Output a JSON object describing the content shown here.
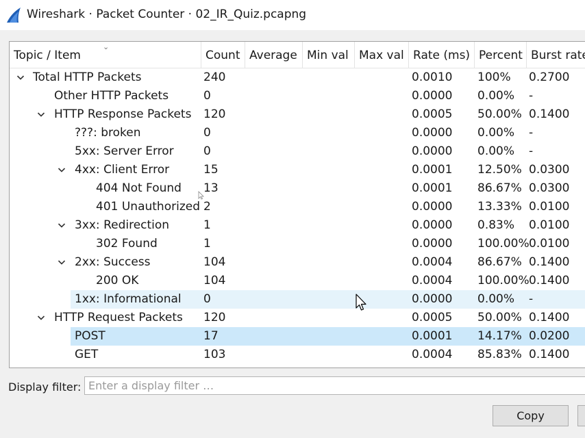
{
  "window": {
    "title": "Wireshark · Packet Counter · 02_IR_Quiz.pcapng",
    "icon": "wireshark-fin-icon",
    "accent": "#1f5fb6"
  },
  "columns": [
    "Topic / Item",
    "Count",
    "Average",
    "Min val",
    "Max val",
    "Rate (ms)",
    "Percent",
    "Burst rate"
  ],
  "rows": [
    {
      "level": 0,
      "expander": "open",
      "topic": "Total HTTP Packets",
      "count": "240",
      "rate": "0.0010",
      "percent": "100%",
      "burst": "0.2700"
    },
    {
      "level": 1,
      "expander": "none",
      "topic": "Other HTTP Packets",
      "count": "0",
      "rate": "0.0000",
      "percent": "0.00%",
      "burst": "-"
    },
    {
      "level": 1,
      "expander": "open",
      "topic": "HTTP Response Packets",
      "count": "120",
      "rate": "0.0005",
      "percent": "50.00%",
      "burst": "0.1400"
    },
    {
      "level": 2,
      "expander": "none",
      "topic": "???: broken",
      "count": "0",
      "rate": "0.0000",
      "percent": "0.00%",
      "burst": "-"
    },
    {
      "level": 2,
      "expander": "none",
      "topic": "5xx: Server Error",
      "count": "0",
      "rate": "0.0000",
      "percent": "0.00%",
      "burst": "-"
    },
    {
      "level": 2,
      "expander": "open",
      "topic": "4xx: Client Error",
      "count": "15",
      "rate": "0.0001",
      "percent": "12.50%",
      "burst": "0.0300"
    },
    {
      "level": 3,
      "expander": "none",
      "topic": "404 Not Found",
      "count": "13",
      "rate": "0.0001",
      "percent": "86.67%",
      "burst": "0.0300"
    },
    {
      "level": 3,
      "expander": "none",
      "topic": "401 Unauthorized",
      "count": "2",
      "rate": "0.0000",
      "percent": "13.33%",
      "burst": "0.0100"
    },
    {
      "level": 2,
      "expander": "open",
      "topic": "3xx: Redirection",
      "count": "1",
      "rate": "0.0000",
      "percent": "0.83%",
      "burst": "0.0100"
    },
    {
      "level": 3,
      "expander": "none",
      "topic": "302 Found",
      "count": "1",
      "rate": "0.0000",
      "percent": "100.00%",
      "burst": "0.0100"
    },
    {
      "level": 2,
      "expander": "open",
      "topic": "2xx: Success",
      "count": "104",
      "rate": "0.0004",
      "percent": "86.67%",
      "burst": "0.1400"
    },
    {
      "level": 3,
      "expander": "none",
      "topic": "200 OK",
      "count": "104",
      "rate": "0.0004",
      "percent": "100.00%",
      "burst": "0.1400"
    },
    {
      "level": 2,
      "expander": "none",
      "topic": "1xx: Informational",
      "count": "0",
      "rate": "0.0000",
      "percent": "0.00%",
      "burst": "-",
      "state": "hover"
    },
    {
      "level": 1,
      "expander": "open",
      "topic": "HTTP Request Packets",
      "count": "120",
      "rate": "0.0005",
      "percent": "50.00%",
      "burst": "0.1400"
    },
    {
      "level": 2,
      "expander": "none",
      "topic": "POST",
      "count": "17",
      "rate": "0.0001",
      "percent": "14.17%",
      "burst": "0.0200",
      "state": "selected"
    },
    {
      "level": 2,
      "expander": "none",
      "topic": "GET",
      "count": "103",
      "rate": "0.0004",
      "percent": "85.83%",
      "burst": "0.1400"
    }
  ],
  "filter": {
    "label": "Display filter:",
    "value": "",
    "placeholder": "Enter a display filter …"
  },
  "buttons": {
    "copy": "Copy"
  },
  "colors": {
    "hover": "#e5f3fb",
    "selected": "#cce8fa"
  }
}
